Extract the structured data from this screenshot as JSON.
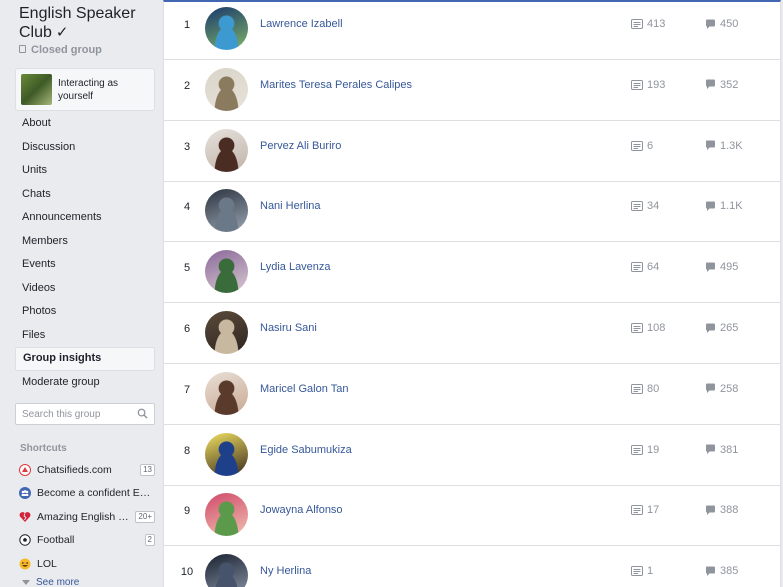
{
  "group": {
    "title": "English Speaker Club",
    "verified_mark": "✓",
    "privacy": "Closed group",
    "interacting_as": "Interacting as yourself"
  },
  "nav": [
    {
      "label": "About",
      "active": false
    },
    {
      "label": "Discussion",
      "active": false
    },
    {
      "label": "Units",
      "active": false
    },
    {
      "label": "Chats",
      "active": false
    },
    {
      "label": "Announcements",
      "active": false
    },
    {
      "label": "Members",
      "active": false
    },
    {
      "label": "Events",
      "active": false
    },
    {
      "label": "Videos",
      "active": false
    },
    {
      "label": "Photos",
      "active": false
    },
    {
      "label": "Files",
      "active": false
    },
    {
      "label": "Group insights",
      "active": true
    },
    {
      "label": "Moderate group",
      "active": false
    }
  ],
  "search": {
    "placeholder": "Search this group"
  },
  "shortcuts": {
    "title": "Shortcuts",
    "items": [
      {
        "label": "Chatsifieds.com",
        "count": "13",
        "icon": "chatsifieds-logo-icon",
        "icon_color": "#e0393e"
      },
      {
        "label": "Become a confident En…",
        "count": "",
        "icon": "group-people-icon",
        "icon_color": "#4267b2"
      },
      {
        "label": "Amazing English C…",
        "count": "20+",
        "icon": "broken-heart-icon",
        "icon_color": "#d0243b"
      },
      {
        "label": "Football",
        "count": "2",
        "icon": "soccer-ball-icon",
        "icon_color": "#1d2129"
      },
      {
        "label": "LOL",
        "count": "",
        "icon": "laughing-emoji-icon",
        "icon_color": "#f7b928"
      }
    ],
    "see_more": "See more"
  },
  "members": [
    {
      "rank": "1",
      "name": "Lawrence Izabell",
      "posts": "413",
      "comments": "450",
      "avatar_colors": [
        "#1a3a6b",
        "#3d9ad1",
        "#7fb36a"
      ]
    },
    {
      "rank": "2",
      "name": "Marites Teresa Perales Calipes",
      "posts": "193",
      "comments": "352",
      "avatar_colors": [
        "#d9d4c8",
        "#8a7a5e",
        "#e8e3da"
      ]
    },
    {
      "rank": "3",
      "name": "Pervez Ali Buriro",
      "posts": "6",
      "comments": "1.3K",
      "avatar_colors": [
        "#e6e1dc",
        "#4a2c22",
        "#bfb3a8"
      ]
    },
    {
      "rank": "4",
      "name": "Nani Herlina",
      "posts": "34",
      "comments": "1.1K",
      "avatar_colors": [
        "#2c3340",
        "#6a7888",
        "#9aa6b2"
      ]
    },
    {
      "rank": "5",
      "name": "Lydia Lavenza",
      "posts": "64",
      "comments": "495",
      "avatar_colors": [
        "#8a6a9a",
        "#3a6b3a",
        "#d8c8d0"
      ]
    },
    {
      "rank": "6",
      "name": "Nasiru Sani",
      "posts": "108",
      "comments": "265",
      "avatar_colors": [
        "#5a4a3a",
        "#c9b8a0",
        "#2e2520"
      ]
    },
    {
      "rank": "7",
      "name": "Maricel Galon Tan",
      "posts": "80",
      "comments": "258",
      "avatar_colors": [
        "#e8dfd6",
        "#5a3a2a",
        "#c9a892"
      ]
    },
    {
      "rank": "8",
      "name": "Egide Sabumukiza",
      "posts": "19",
      "comments": "381",
      "avatar_colors": [
        "#f0e060",
        "#1e3f8a",
        "#3a2a20"
      ]
    },
    {
      "rank": "9",
      "name": "Jowayna Alfonso",
      "posts": "17",
      "comments": "388",
      "avatar_colors": [
        "#d04a6a",
        "#5a9a4a",
        "#f0c0b0"
      ]
    },
    {
      "rank": "10",
      "name": "Ny Herlina",
      "posts": "1",
      "comments": "385",
      "avatar_colors": [
        "#1a2230",
        "#46536a",
        "#8a95a8"
      ]
    }
  ]
}
